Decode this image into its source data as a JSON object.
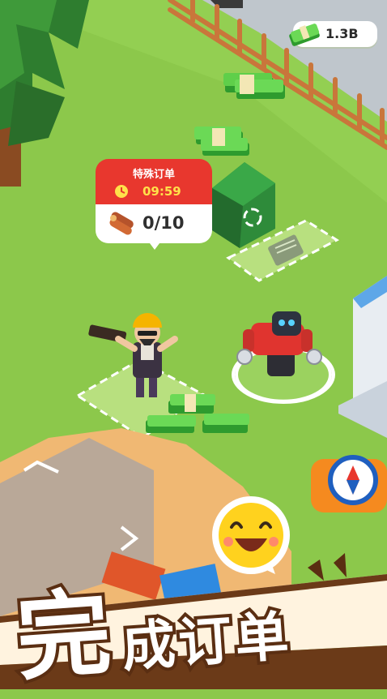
{
  "hud": {
    "money": "1.3B"
  },
  "order": {
    "title": "特殊订单",
    "timer": "09:59",
    "progress": "0/10"
  },
  "banner": {
    "big": "完",
    "rest": "成订单"
  },
  "colors": {
    "grass": "#8cc84b",
    "order_red": "#e8372e",
    "timer_yellow": "#ffe14a",
    "banner_brown": "#5a2e12"
  },
  "icons": [
    "cash-stack-icon",
    "clock-icon",
    "logs-icon",
    "compass-icon",
    "recycle-icon",
    "document-icon",
    "smiley-emoji-icon"
  ]
}
